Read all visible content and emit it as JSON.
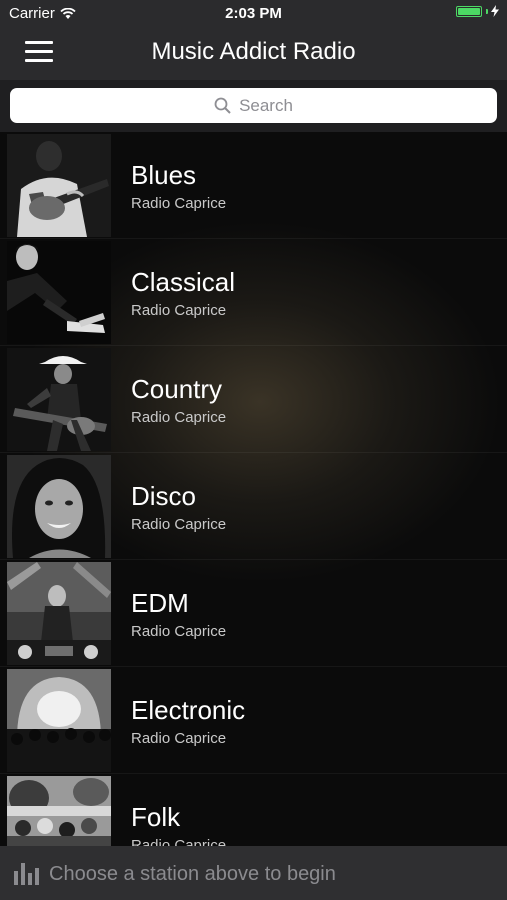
{
  "status": {
    "carrier": "Carrier",
    "time": "2:03 PM",
    "battery_level": 1.0,
    "battery_color": "#4cd964"
  },
  "nav": {
    "title": "Music Addict Radio",
    "menu_icon": "hamburger-menu-icon"
  },
  "search": {
    "placeholder": "Search",
    "icon": "search-icon"
  },
  "stations": [
    {
      "name": "Blues",
      "provider": "Radio Caprice"
    },
    {
      "name": "Classical",
      "provider": "Radio Caprice"
    },
    {
      "name": "Country",
      "provider": "Radio Caprice"
    },
    {
      "name": "Disco",
      "provider": "Radio Caprice"
    },
    {
      "name": "EDM",
      "provider": "Radio Caprice"
    },
    {
      "name": "Electronic",
      "provider": "Radio Caprice"
    },
    {
      "name": "Folk",
      "provider": "Radio Caprice"
    }
  ],
  "player": {
    "message": "Choose a station above to begin",
    "icon": "equalizer-icon"
  }
}
